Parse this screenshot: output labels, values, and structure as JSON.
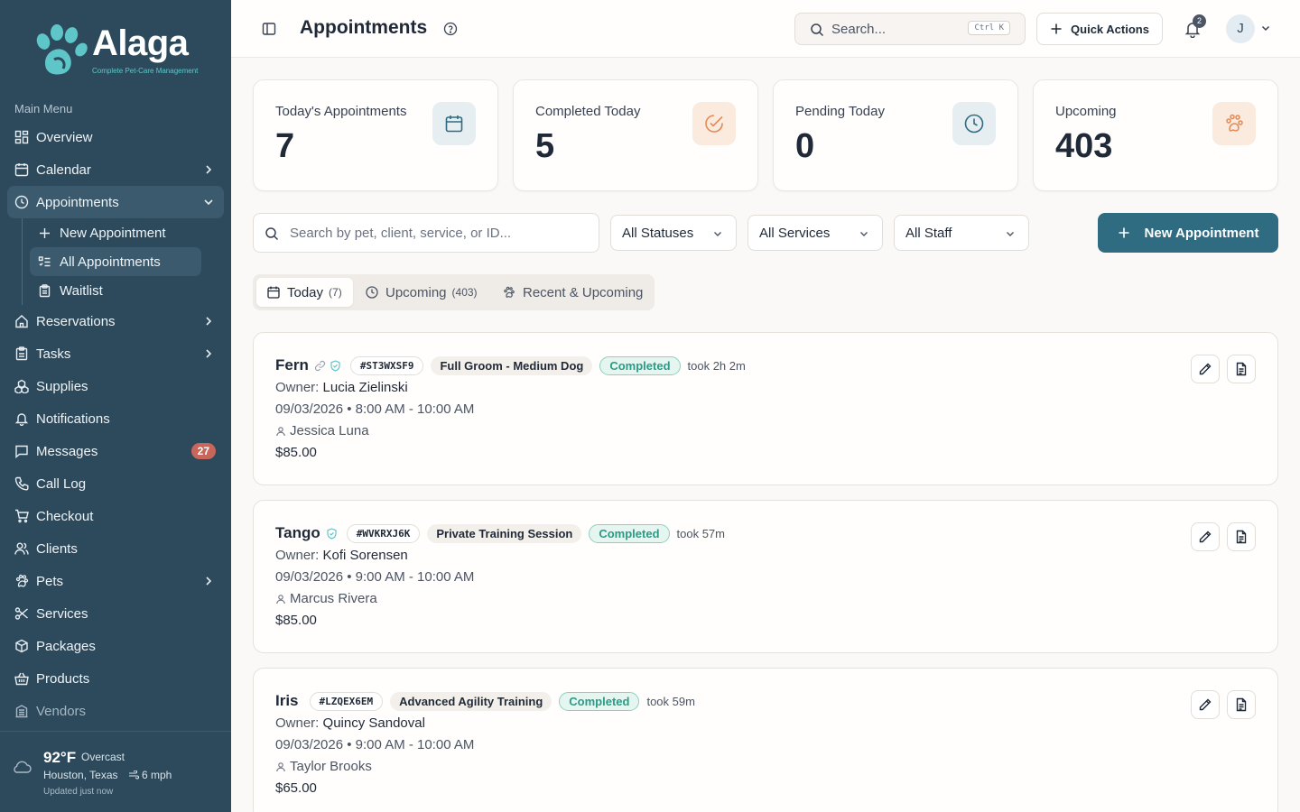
{
  "brand": {
    "name": "Alaga",
    "tagline": "Complete Pet-Care Management"
  },
  "sidebar": {
    "heading": "Main Menu",
    "items": [
      {
        "label": "Overview"
      },
      {
        "label": "Calendar"
      },
      {
        "label": "Appointments"
      },
      {
        "label": "Reservations"
      },
      {
        "label": "Tasks"
      },
      {
        "label": "Supplies"
      },
      {
        "label": "Notifications"
      },
      {
        "label": "Messages",
        "badge": "27"
      },
      {
        "label": "Call Log"
      },
      {
        "label": "Checkout"
      },
      {
        "label": "Clients"
      },
      {
        "label": "Pets"
      },
      {
        "label": "Services"
      },
      {
        "label": "Packages"
      },
      {
        "label": "Products"
      },
      {
        "label": "Vendors"
      }
    ],
    "appointments_sub": [
      {
        "label": "New Appointment"
      },
      {
        "label": "All Appointments"
      },
      {
        "label": "Waitlist"
      }
    ]
  },
  "weather": {
    "temp": "92°F",
    "condition": "Overcast",
    "location": "Houston, Texas",
    "wind": "6 mph",
    "updated": "Updated just now"
  },
  "header": {
    "title": "Appointments",
    "search_placeholder": "Search...",
    "shortcut": "Ctrl K",
    "quick_actions": "Quick Actions",
    "notifications_count": "2",
    "avatar_initial": "J"
  },
  "stats": [
    {
      "label": "Today's Appointments",
      "value": "7",
      "icon": "calendar-icon",
      "color": "#2f6b81"
    },
    {
      "label": "Completed Today",
      "value": "5",
      "icon": "check-circle-icon",
      "color": "#e58a55"
    },
    {
      "label": "Pending Today",
      "value": "0",
      "icon": "clock-icon",
      "color": "#2f6b81"
    },
    {
      "label": "Upcoming",
      "value": "403",
      "icon": "paw-icon",
      "color": "#e58a55"
    }
  ],
  "filters": {
    "search_placeholder": "Search by pet, client, service, or ID...",
    "status": "All Statuses",
    "services": "All Services",
    "staff": "All Staff",
    "new_button": "New Appointment"
  },
  "tabs": [
    {
      "label": "Today",
      "count": "(7)"
    },
    {
      "label": "Upcoming",
      "count": "(403)"
    },
    {
      "label": "Recent & Upcoming",
      "count": ""
    }
  ],
  "appointments": [
    {
      "pet": "Fern",
      "code": "#ST3WXSF9",
      "service": "Full Groom - Medium Dog",
      "status": "Completed",
      "took": "took 2h 2m",
      "owner_label": "Owner:",
      "owner": "Lucia Zielinski",
      "when": "09/03/2026 • 8:00 AM - 10:00 AM",
      "staff": "Jessica Luna",
      "price": "$85.00"
    },
    {
      "pet": "Tango",
      "code": "#WVKRXJ6K",
      "service": "Private Training Session",
      "status": "Completed",
      "took": "took 57m",
      "owner_label": "Owner:",
      "owner": "Kofi Sorensen",
      "when": "09/03/2026 • 9:00 AM - 10:00 AM",
      "staff": "Marcus Rivera",
      "price": "$85.00"
    },
    {
      "pet": "Iris",
      "code": "#LZQEX6EM",
      "service": "Advanced Agility Training",
      "status": "Completed",
      "took": "took 59m",
      "owner_label": "Owner:",
      "owner": "Quincy Sandoval",
      "when": "09/03/2026 • 9:00 AM - 10:00 AM",
      "staff": "Taylor Brooks",
      "price": "$65.00"
    }
  ],
  "colors": {
    "sidebar": "#2d4a5d",
    "primary": "#2f6b81",
    "accent": "#e58a55",
    "success": "#2c9a86"
  }
}
